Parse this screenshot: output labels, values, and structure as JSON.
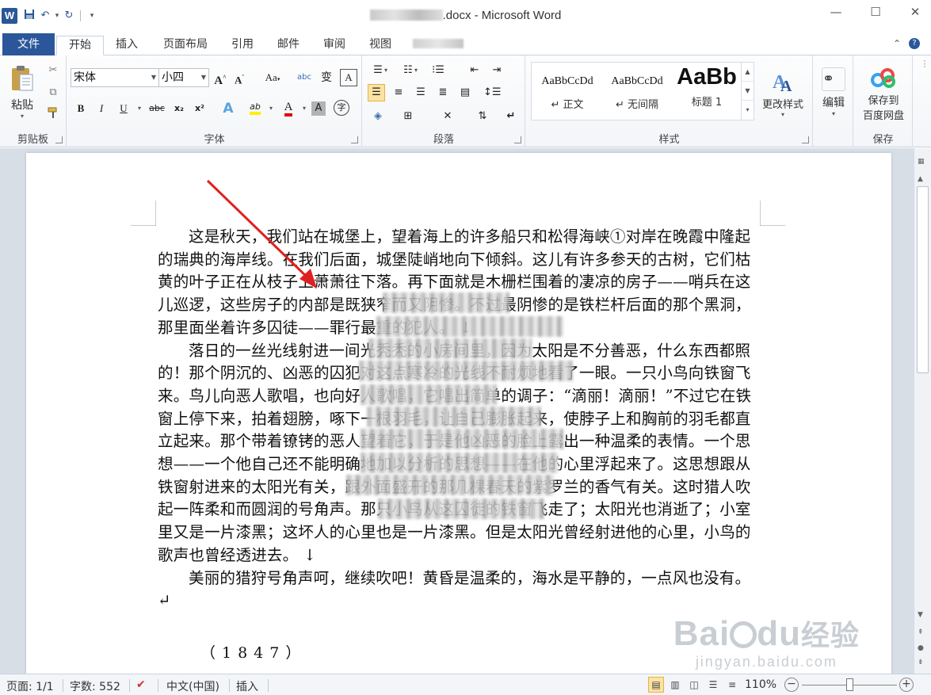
{
  "window": {
    "title_prefix_redacted": "",
    "title": ".docx - Microsoft Word",
    "minimize": "—",
    "maximize": "☐",
    "close": "✕"
  },
  "qat": {
    "undo": "↶",
    "redo": "↻",
    "dropdown": "▾"
  },
  "tabs": [
    {
      "label": "文件"
    },
    {
      "label": "开始"
    },
    {
      "label": "插入"
    },
    {
      "label": "页面布局"
    },
    {
      "label": "引用"
    },
    {
      "label": "邮件"
    },
    {
      "label": "审阅"
    },
    {
      "label": "视图"
    }
  ],
  "ribbon": {
    "clipboard": {
      "paste": "粘贴",
      "label": "剪贴板"
    },
    "font": {
      "name": "宋体",
      "size": "小四",
      "label": "字体",
      "grow": "A",
      "shrink": "A",
      "case": "Aa",
      "clear": "abc",
      "phonetic": "变",
      "border": "A",
      "bold": "B",
      "italic": "I",
      "underline": "U",
      "strike": "abc",
      "sub": "x₂",
      "sup": "x²",
      "effects": "A",
      "highlight": "ab",
      "color": "A",
      "shade": "A",
      "enclose": "字"
    },
    "paragraph": {
      "label": "段落"
    },
    "styles": {
      "label": "样式",
      "items": [
        {
          "preview": "AaBbCcDd",
          "name": "↵ 正文"
        },
        {
          "preview": "AaBbCcDd",
          "name": "↵ 无间隔"
        },
        {
          "preview": "AaBb",
          "name": "标题 1"
        }
      ],
      "change": "更改样式"
    },
    "editing": {
      "label": "编辑"
    },
    "save": {
      "label1": "保存到",
      "label2": "百度网盘",
      "group": "保存"
    }
  },
  "document": {
    "paragraphs": [
      "这是秋天，我们站在城堡上，望着海上的许多船只和松得海峡①对岸在晚霞中隆起的瑞典的海岸线。在我们后面，城堡陡峭地向下倾斜。这儿有许多参天的古树，它们枯黄的叶子正在从枝子上萧萧往下落。再下面就是木栅栏围着的凄凉的房子——哨兵在这儿巡逻，这些房子的内部是既狭窄而又阴惨。不过最阴惨的是铁栏杆后面的那个黑洞，那里面坐着许多囚徒——罪行最重的犯人。 ↓",
      "落日的一丝光线射进一间光秃秃的小房间里，因为太阳是不分善恶，什么东西都照的！那个阴沉的、凶恶的囚犯对这点寒冷的光线不耐烦地看了一眼。一只小鸟向铁窗飞来。鸟儿向恶人歌唱，也向好人歌唱，它唱出简单的调子：“滴丽！滴丽！”不过它在铁窗上停下来，拍着翅膀，啄下一根羽毛，让自己膨胀起来，使脖子上和胸前的羽毛都直立起来。那个带着镣铐的恶人望着它，于是他凶恶的脸上露出一种温柔的表情。一个思想——一个他自己还不能明确地加以分析的思想——在他的心里浮起来了。这思想跟从铁窗射进来的太阳光有关，跟外面盛开的那几棵春天的紫罗兰的香气有关。这时猎人吹起一阵柔和而圆润的号角声。那只小鸟从这囚徒的铁窗飞走了；太阳光也消逝了；小室里又是一片漆黑；这坏人的心里也是一片漆黑。但是太阳光曾经射进他的心里，小鸟的歌声也曾经透进去。 ↓",
      "美丽的猎狩号角声呵，继续吹吧！黄昏是温柔的，海水是平静的，一点风也没有。 ↵"
    ],
    "year": "（1847）"
  },
  "watermark": {
    "text1": "Bai",
    "text2": "du",
    "text3": "经验",
    "url": "jingyan.baidu.com"
  },
  "status": {
    "page": "页面: 1/1",
    "words": "字数: 552",
    "lang": "中文(中国)",
    "mode": "插入",
    "zoom": "110%"
  }
}
